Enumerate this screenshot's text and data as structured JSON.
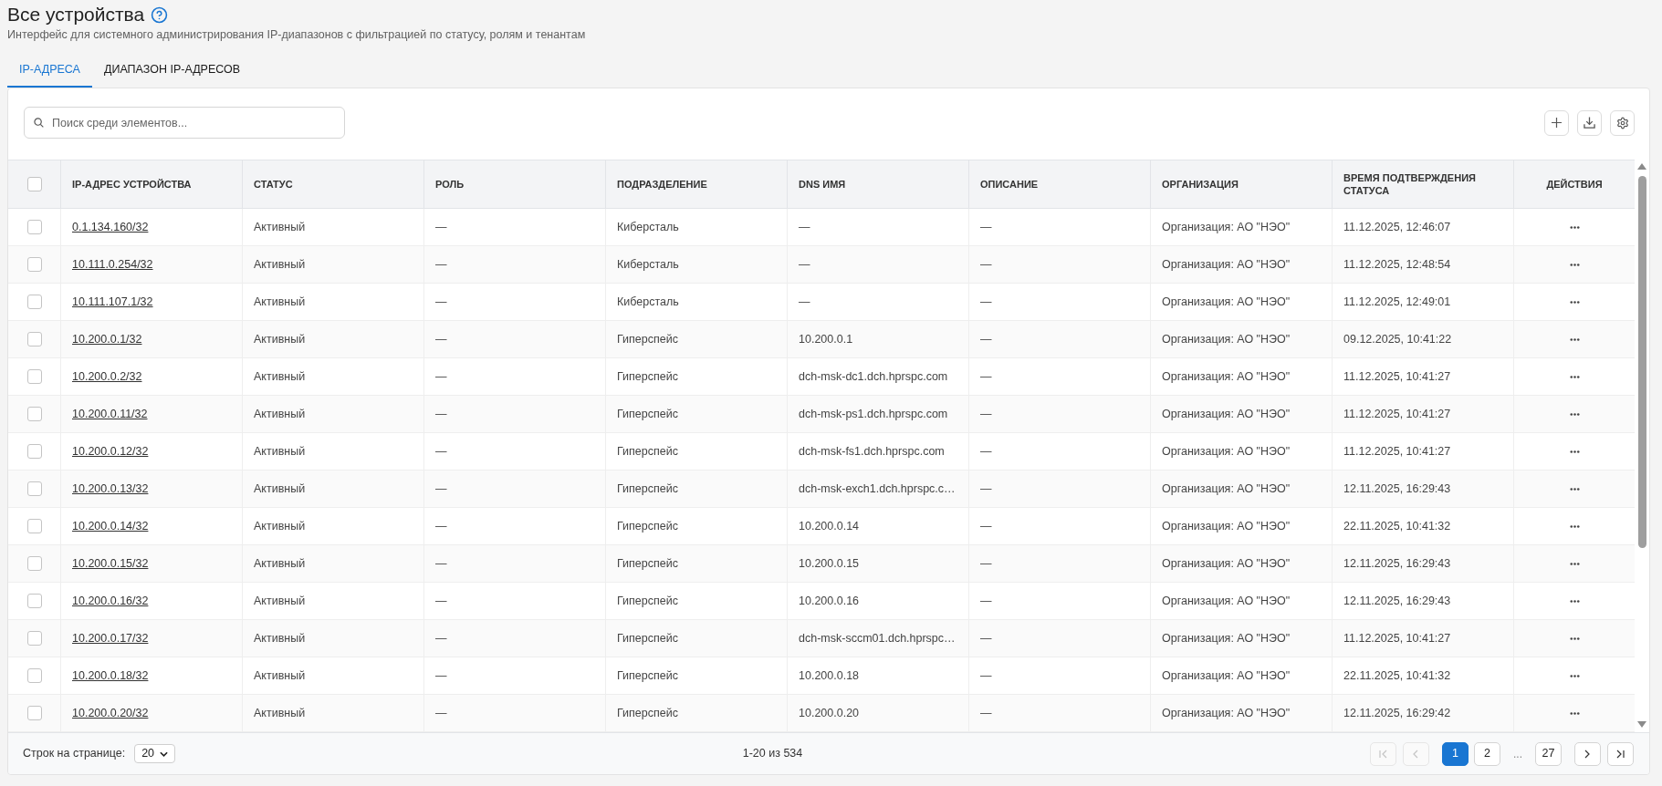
{
  "header": {
    "title": "Все устройства",
    "subtitle": "Интерфейс для системного администрирования IP-диапазонов с фильтрацией по статусу, ролям и тенантам"
  },
  "tabs": [
    {
      "label": "IP-АДРЕСА",
      "selected": true
    },
    {
      "label": "ДИАПАЗОН IP-АДРЕСОВ",
      "selected": false
    }
  ],
  "search": {
    "placeholder": "Поиск среди элементов..."
  },
  "toolbar": [
    {
      "kind": "add"
    },
    {
      "kind": "download"
    },
    {
      "kind": "settings"
    }
  ],
  "table": {
    "select_all": {
      "checked": false
    },
    "columns": [
      "IP-АДРЕС УСТРОЙСТВА",
      "СТАТУС",
      "РОЛЬ",
      "ПОДРАЗДЕЛЕНИЕ",
      "DNS ИМЯ",
      "ОПИСАНИЕ",
      "ОРГАНИЗАЦИЯ",
      "ВРЕМЯ ПОДТВЕРЖДЕНИЯ СТАТУСА",
      "ДЕЙСТВИЯ"
    ],
    "rows": [
      {
        "checked": false,
        "ip": "0.1.134.160/32",
        "status": "Активный",
        "role": "—",
        "subdivision": "Киберсталь",
        "dns": "—",
        "description": "—",
        "organization": "Организация: АО \"НЭО\"",
        "confirmed_at": "11.12.2025, 12:46:07"
      },
      {
        "checked": false,
        "ip": "10.111.0.254/32",
        "status": "Активный",
        "role": "—",
        "subdivision": "Киберсталь",
        "dns": "—",
        "description": "—",
        "organization": "Организация: АО \"НЭО\"",
        "confirmed_at": "11.12.2025, 12:48:54"
      },
      {
        "checked": false,
        "ip": "10.111.107.1/32",
        "status": "Активный",
        "role": "—",
        "subdivision": "Киберсталь",
        "dns": "—",
        "description": "—",
        "organization": "Организация: АО \"НЭО\"",
        "confirmed_at": "11.12.2025, 12:49:01"
      },
      {
        "checked": false,
        "ip": "10.200.0.1/32",
        "status": "Активный",
        "role": "—",
        "subdivision": "Гиперспейс",
        "dns": "10.200.0.1",
        "description": "—",
        "organization": "Организация: АО \"НЭО\"",
        "confirmed_at": "09.12.2025, 10:41:22"
      },
      {
        "checked": false,
        "ip": "10.200.0.2/32",
        "status": "Активный",
        "role": "—",
        "subdivision": "Гиперспейс",
        "dns": "dch-msk-dc1.dch.hprspc.com",
        "description": "—",
        "organization": "Организация: АО \"НЭО\"",
        "confirmed_at": "11.12.2025, 10:41:27"
      },
      {
        "checked": false,
        "ip": "10.200.0.11/32",
        "status": "Активный",
        "role": "—",
        "subdivision": "Гиперспейс",
        "dns": "dch-msk-ps1.dch.hprspc.com",
        "description": "—",
        "organization": "Организация: АО \"НЭО\"",
        "confirmed_at": "11.12.2025, 10:41:27"
      },
      {
        "checked": false,
        "ip": "10.200.0.12/32",
        "status": "Активный",
        "role": "—",
        "subdivision": "Гиперспейс",
        "dns": "dch-msk-fs1.dch.hprspc.com",
        "description": "—",
        "organization": "Организация: АО \"НЭО\"",
        "confirmed_at": "11.12.2025, 10:41:27"
      },
      {
        "checked": false,
        "ip": "10.200.0.13/32",
        "status": "Активный",
        "role": "—",
        "subdivision": "Гиперспейс",
        "dns": "dch-msk-exch1.dch.hprspc.c…",
        "description": "—",
        "organization": "Организация: АО \"НЭО\"",
        "confirmed_at": "12.11.2025, 16:29:43"
      },
      {
        "checked": false,
        "ip": "10.200.0.14/32",
        "status": "Активный",
        "role": "—",
        "subdivision": "Гиперспейс",
        "dns": "10.200.0.14",
        "description": "—",
        "organization": "Организация: АО \"НЭО\"",
        "confirmed_at": "22.11.2025, 10:41:32"
      },
      {
        "checked": false,
        "ip": "10.200.0.15/32",
        "status": "Активный",
        "role": "—",
        "subdivision": "Гиперспейс",
        "dns": "10.200.0.15",
        "description": "—",
        "organization": "Организация: АО \"НЭО\"",
        "confirmed_at": "12.11.2025, 16:29:43"
      },
      {
        "checked": false,
        "ip": "10.200.0.16/32",
        "status": "Активный",
        "role": "—",
        "subdivision": "Гиперспейс",
        "dns": "10.200.0.16",
        "description": "—",
        "organization": "Организация: АО \"НЭО\"",
        "confirmed_at": "12.11.2025, 16:29:43"
      },
      {
        "checked": false,
        "ip": "10.200.0.17/32",
        "status": "Активный",
        "role": "—",
        "subdivision": "Гиперспейс",
        "dns": "dch-msk-sccm01.dch.hprspc…",
        "description": "—",
        "organization": "Организация: АО \"НЭО\"",
        "confirmed_at": "11.12.2025, 10:41:27"
      },
      {
        "checked": false,
        "ip": "10.200.0.18/32",
        "status": "Активный",
        "role": "—",
        "subdivision": "Гиперспейс",
        "dns": "10.200.0.18",
        "description": "—",
        "organization": "Организация: АО \"НЭО\"",
        "confirmed_at": "22.11.2025, 10:41:32"
      },
      {
        "checked": false,
        "ip": "10.200.0.20/32",
        "status": "Активный",
        "role": "—",
        "subdivision": "Гиперспейс",
        "dns": "10.200.0.20",
        "description": "—",
        "organization": "Организация: АО \"НЭО\"",
        "confirmed_at": "12.11.2025, 16:29:42"
      }
    ]
  },
  "pagination": {
    "rows_per_page_label": "Строк на странице:",
    "rows_per_page": "20",
    "range": "1-20 из 534",
    "first": {
      "disabled": true
    },
    "previous": {
      "disabled": true
    },
    "pages": [
      {
        "kind": "page",
        "label": "1",
        "selected": true
      },
      {
        "kind": "page",
        "label": "2",
        "selected": false
      },
      {
        "kind": "ellipsis",
        "label": "..."
      },
      {
        "kind": "page",
        "label": "27",
        "selected": false
      }
    ],
    "next": {
      "disabled": false
    },
    "last": {
      "disabled": false
    }
  }
}
